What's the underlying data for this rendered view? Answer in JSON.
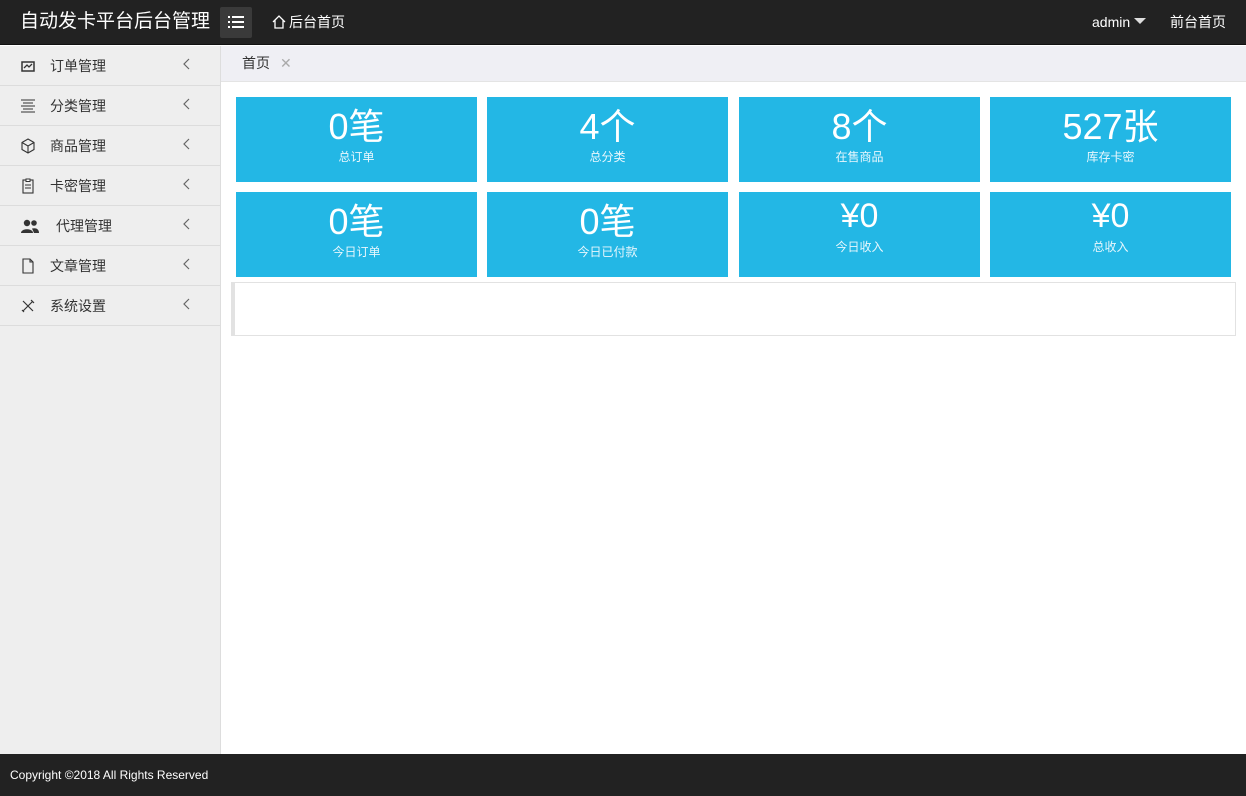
{
  "header": {
    "brand": "自动发卡平台后台管理",
    "home_link": "后台首页",
    "user": "admin",
    "front_link": "前台首页"
  },
  "sidebar": {
    "items": [
      {
        "label": "订单管理",
        "icon": "chart-icon"
      },
      {
        "label": "分类管理",
        "icon": "align-icon"
      },
      {
        "label": "商品管理",
        "icon": "cube-icon"
      },
      {
        "label": "卡密管理",
        "icon": "clipboard-icon"
      },
      {
        "label": "代理管理",
        "icon": "users-icon"
      },
      {
        "label": "文章管理",
        "icon": "file-icon"
      },
      {
        "label": "系统设置",
        "icon": "tools-icon"
      }
    ]
  },
  "tabs": [
    {
      "label": "首页"
    }
  ],
  "stats": [
    {
      "value": "0笔",
      "caption": "总订单"
    },
    {
      "value": "4个",
      "caption": "总分类"
    },
    {
      "value": "8个",
      "caption": "在售商品"
    },
    {
      "value": "527张",
      "caption": "库存卡密"
    },
    {
      "value": "0笔",
      "caption": "今日订单"
    },
    {
      "value": "0笔",
      "caption": "今日已付款"
    },
    {
      "value": "¥0",
      "caption": "今日收入"
    },
    {
      "value": "¥0",
      "caption": "总收入"
    }
  ],
  "footer": {
    "copyright": "Copyright ©2018 All Rights Reserved"
  },
  "colors": {
    "header_bg": "#222222",
    "card_bg": "#23b7e5",
    "sidebar_bg": "#eeeeee"
  }
}
